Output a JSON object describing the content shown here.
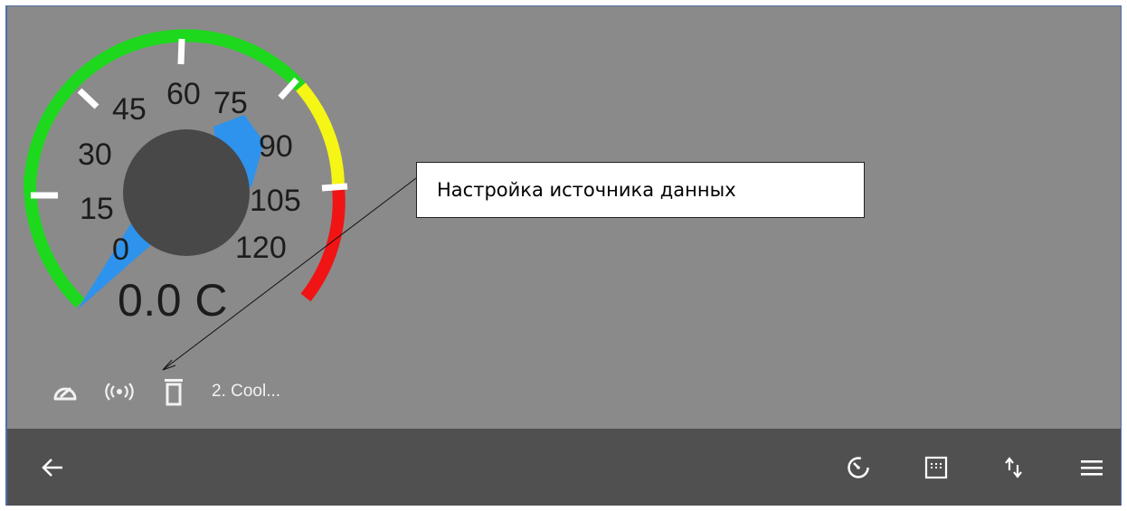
{
  "gauge": {
    "value_text": "0.0 C",
    "ticks": [
      "0",
      "15",
      "30",
      "45",
      "60",
      "75",
      "90",
      "105",
      "120"
    ],
    "zones": {
      "green": "#1ed81e",
      "yellow": "#f5f516",
      "red": "#f01414"
    },
    "needle_color": "#2e93ec",
    "hub_color": "#484848"
  },
  "tile_toolbar": {
    "gauge_icon": "speedometer-icon",
    "source_icon": "broadcast-icon",
    "delete_icon": "trash-icon",
    "name": "2. Cool..."
  },
  "callout": {
    "text": "Настройка источника данных"
  },
  "bottom_bar": {
    "back_icon": "arrow-left-icon",
    "timer_icon": "timer-icon",
    "grid_icon": "grid-icon",
    "sort_icon": "swap-vertical-icon",
    "menu_icon": "hamburger-menu-icon"
  }
}
